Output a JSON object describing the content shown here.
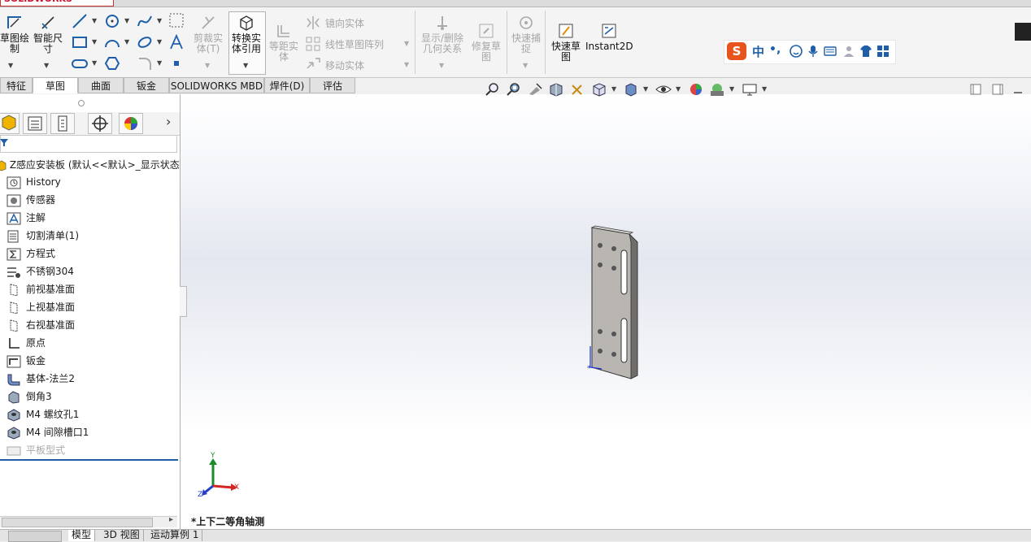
{
  "app": {
    "logo_text": "SOLIDWORKS"
  },
  "ribbon": {
    "sketch_draw": "草图绘\n制",
    "smart_dim": "智能尺\n寸",
    "trim": "剪裁实\n体(T)",
    "convert": "转换实\n体引用",
    "offset": "等距实\n体",
    "mirror": "镜向实体",
    "linear_pattern": "线性草图阵列",
    "move": "移动实体",
    "show_delete": "显示/删除\n几何关系",
    "repair": "修复草\n图",
    "quick_snap": "快速捕\n捉",
    "rapid_sketch": "快速草\n图",
    "instant2d": "Instant2D"
  },
  "ime": {
    "lang": "中",
    "punct": "•,"
  },
  "tabs": [
    "特征",
    "草图",
    "曲面",
    "钣金",
    "SOLIDWORKS MBD",
    "焊件(D)",
    "评估"
  ],
  "active_tab": 1,
  "tree": {
    "root": "Z感应安装板 (默认<<默认>_显示状态",
    "items": [
      {
        "label": "History",
        "icon": "history-icon"
      },
      {
        "label": "传感器",
        "icon": "sensor-icon"
      },
      {
        "label": "注解",
        "icon": "annotation-icon"
      },
      {
        "label": "切割清单(1)",
        "icon": "cutlist-icon"
      },
      {
        "label": "方程式",
        "icon": "equation-icon"
      },
      {
        "label": "不锈钢304",
        "icon": "material-icon"
      },
      {
        "label": "前视基准面",
        "icon": "plane-icon"
      },
      {
        "label": "上视基准面",
        "icon": "plane-icon"
      },
      {
        "label": "右视基准面",
        "icon": "plane-icon"
      },
      {
        "label": "原点",
        "icon": "origin-icon"
      },
      {
        "label": "钣金",
        "icon": "sheetmetal-icon"
      },
      {
        "label": "基体-法兰2",
        "icon": "base-flange-icon"
      },
      {
        "label": "倒角3",
        "icon": "chamfer-icon"
      },
      {
        "label": "M4 螺纹孔1",
        "icon": "hole-wizard-icon"
      },
      {
        "label": "M4 间隙槽口1",
        "icon": "hole-wizard-icon"
      },
      {
        "label": "平板型式",
        "icon": "flat-pattern-icon",
        "disabled": true
      }
    ]
  },
  "viewport": {
    "view_name": "*上下二等角轴测"
  },
  "triad": {
    "x": "X",
    "y": "Y",
    "z": "Z"
  },
  "bottom_tabs": [
    "模型",
    "3D 视图",
    "运动算例 1"
  ],
  "colors": {
    "accent_red": "#c8102e",
    "part_gray": "#b9b5b0",
    "triad_x": "#d42424",
    "triad_y": "#1b8a2a",
    "triad_z": "#2540c8"
  }
}
